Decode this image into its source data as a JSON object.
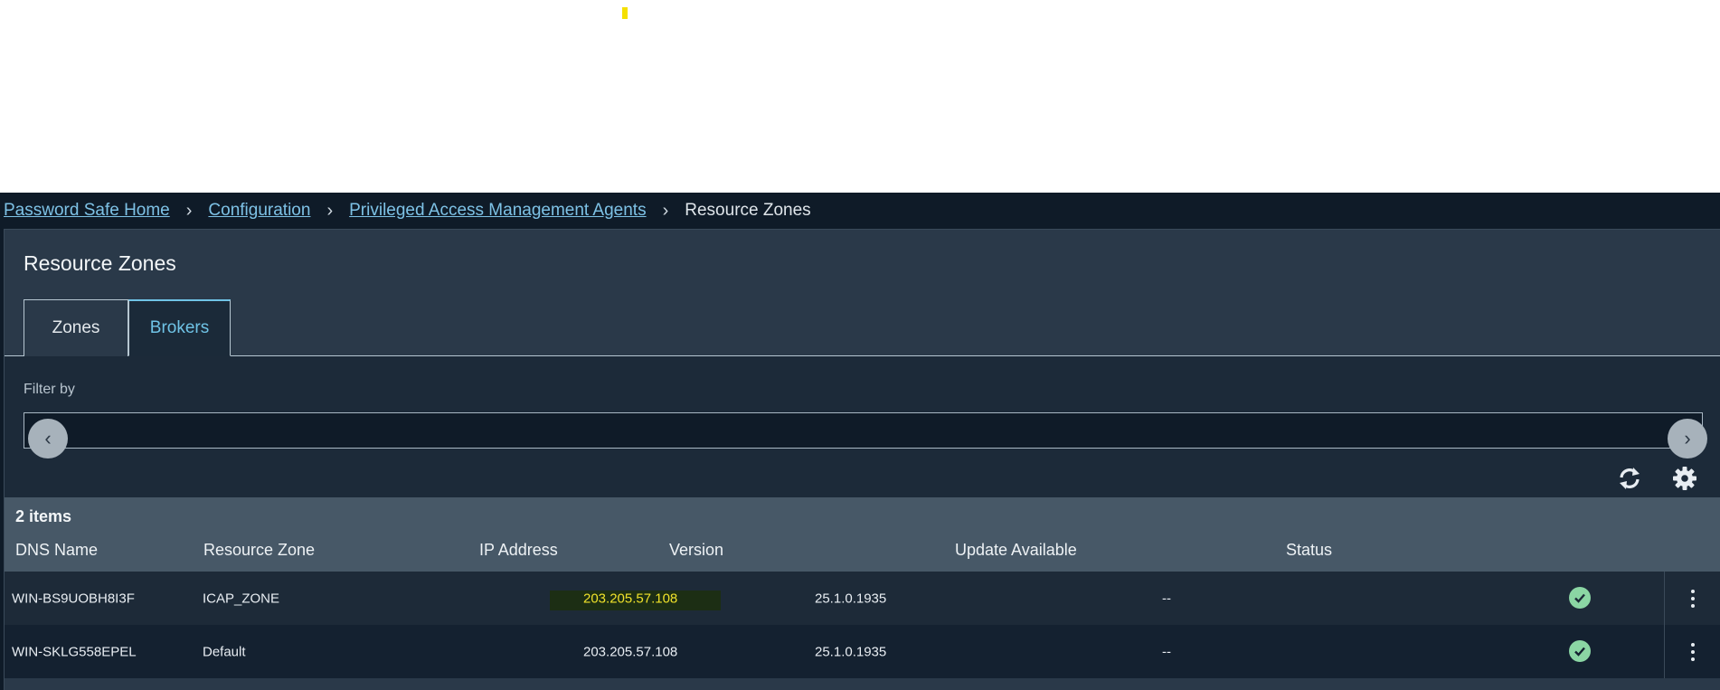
{
  "breadcrumb": {
    "items": [
      {
        "label": "Password Safe Home"
      },
      {
        "label": "Configuration"
      },
      {
        "label": "Privileged Access Management Agents"
      }
    ],
    "current": "Resource Zones"
  },
  "page": {
    "title": "Resource Zones"
  },
  "tabs": [
    {
      "label": "Zones",
      "active": false
    },
    {
      "label": "Brokers",
      "active": true
    }
  ],
  "filter": {
    "label": "Filter by",
    "value": "",
    "placeholder": ""
  },
  "toolbar": {
    "refresh_icon": "refresh-icon",
    "settings_icon": "gear-icon"
  },
  "grid": {
    "count_label": "2 items",
    "columns": [
      "DNS Name",
      "Resource Zone",
      "IP Address",
      "Version",
      "Update Available",
      "Status"
    ],
    "rows": [
      {
        "dns": "WIN-BS9UOBH8I3F",
        "zone": "ICAP_ZONE",
        "ip": "203.205.57.108",
        "version": "25.1.0.1935",
        "update": "--",
        "status": "ok"
      },
      {
        "dns": "WIN-SKLG558EPEL",
        "zone": "Default",
        "ip": "203.205.57.108",
        "version": "25.1.0.1935",
        "update": "--",
        "status": "ok"
      }
    ]
  },
  "colors": {
    "accent": "#6fc3e6",
    "status_ok": "#8bd6a4",
    "highlight_text": "#f0e22a",
    "link": "#7ec2e6"
  }
}
